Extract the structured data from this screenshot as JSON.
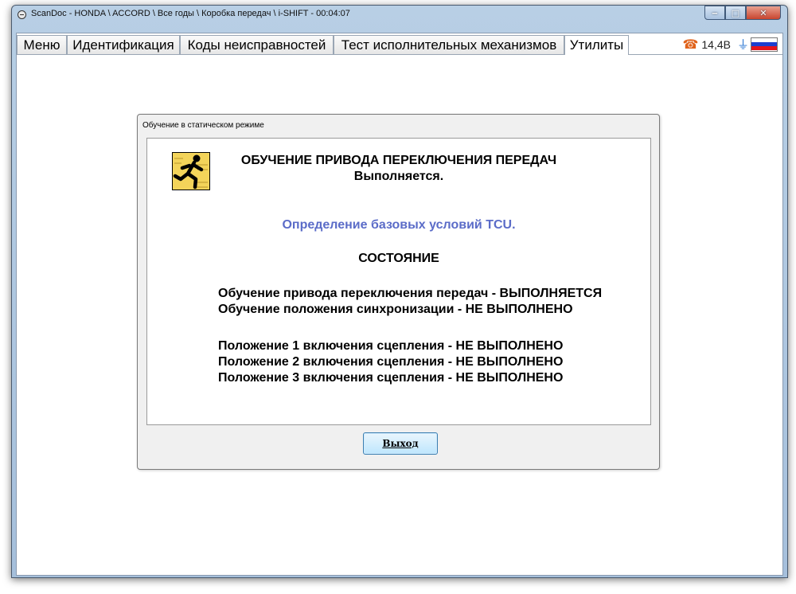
{
  "window": {
    "title": "ScanDoc - HONDA \\ ACCORD \\ Все годы \\ Коробка передач \\ i-SHIFT - 00:04:07",
    "controls": {
      "minimize": "‒",
      "maximize": "□",
      "close": "✕"
    }
  },
  "tabs": [
    {
      "label": "Меню",
      "active": false
    },
    {
      "label": "Идентификация",
      "active": false
    },
    {
      "label": "Коды неисправностей",
      "active": false
    },
    {
      "label": "Тест исполнительных механизмов",
      "active": false
    },
    {
      "label": "Утилиты",
      "active": true
    }
  ],
  "status": {
    "voltage": "14,4В",
    "icons": [
      "phone-icon",
      "plug-icon",
      "russia-flag-icon"
    ],
    "flag_colors": [
      "#ffffff",
      "#1c3fd0",
      "#e4141c"
    ],
    "phone_color": "#e0621a"
  },
  "dialog": {
    "title": "Обучение в статическом режиме",
    "heading": "ОБУЧЕНИЕ ПРИВОДА ПЕРЕКЛЮЧЕНИЯ ПЕРЕДАЧ",
    "subheading": "Выполняется.",
    "info": "Определение базовых условий TCU.",
    "info_color": "#5b6cc8",
    "state_title": "СОСТОЯНИЕ",
    "status_lines": [
      "Обучение привода переключения передач - ВЫПОЛНЯЕТСЯ",
      "Обучение положения синхронизации - НЕ ВЫПОЛНЕНО",
      "Положение 1 включения сцепления - НЕ ВЫПОЛНЕНО",
      "Положение 2 включения сцепления - НЕ ВЫПОЛНЕНО",
      "Положение 3 включения сцепления - НЕ ВЫПОЛНЕНО"
    ],
    "exit_label": "Выход"
  }
}
